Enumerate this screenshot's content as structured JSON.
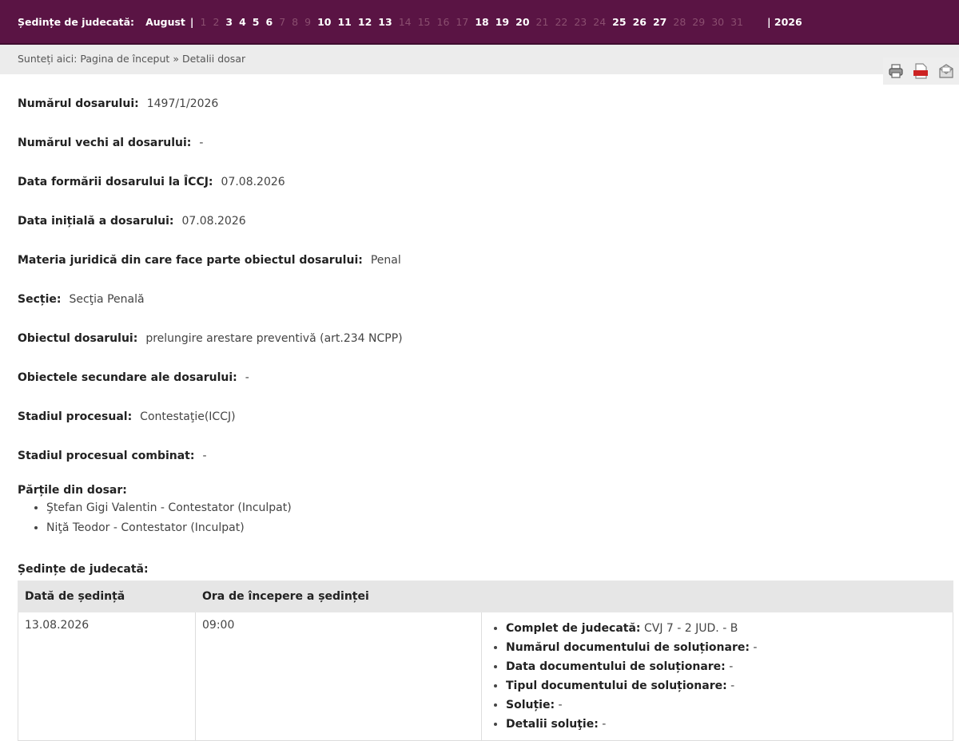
{
  "topbar": {
    "label": "Ședințe de judecată:",
    "month": "August",
    "separator": "|",
    "year": "| 2026",
    "days": [
      {
        "n": "1",
        "active": false
      },
      {
        "n": "2",
        "active": false
      },
      {
        "n": "3",
        "active": true
      },
      {
        "n": "4",
        "active": true
      },
      {
        "n": "5",
        "active": true
      },
      {
        "n": "6",
        "active": true
      },
      {
        "n": "7",
        "active": false
      },
      {
        "n": "8",
        "active": false
      },
      {
        "n": "9",
        "active": false
      },
      {
        "n": "10",
        "active": true
      },
      {
        "n": "11",
        "active": true
      },
      {
        "n": "12",
        "active": true
      },
      {
        "n": "13",
        "active": true
      },
      {
        "n": "14",
        "active": false
      },
      {
        "n": "15",
        "active": false
      },
      {
        "n": "16",
        "active": false
      },
      {
        "n": "17",
        "active": false
      },
      {
        "n": "18",
        "active": true
      },
      {
        "n": "19",
        "active": true
      },
      {
        "n": "20",
        "active": true
      },
      {
        "n": "21",
        "active": false
      },
      {
        "n": "22",
        "active": false
      },
      {
        "n": "23",
        "active": false
      },
      {
        "n": "24",
        "active": false
      },
      {
        "n": "25",
        "active": true
      },
      {
        "n": "26",
        "active": true
      },
      {
        "n": "27",
        "active": true
      },
      {
        "n": "28",
        "active": false
      },
      {
        "n": "29",
        "active": false
      },
      {
        "n": "30",
        "active": false
      },
      {
        "n": "31",
        "active": false
      }
    ]
  },
  "breadcrumb": {
    "prefix": "Sunteți aici:",
    "home": "Pagina de început",
    "sep": "»",
    "current": "Detalii dosar"
  },
  "tools": [
    "printer-icon",
    "pdf-icon",
    "email-icon"
  ],
  "fields": [
    {
      "label": "Numărul dosarului:",
      "value": "1497/1/2026"
    },
    {
      "label": "Numărul vechi al dosarului:",
      "value": "-"
    },
    {
      "label": "Data formării dosarului la ÎCCJ:",
      "value": "07.08.2026"
    },
    {
      "label": "Data inițială a dosarului:",
      "value": "07.08.2026"
    },
    {
      "label": "Materia juridică din care face parte obiectul dosarului:",
      "value": "Penal"
    },
    {
      "label": "Secție:",
      "value": "Secţia Penală"
    },
    {
      "label": "Obiectul dosarului:",
      "value": "prelungire arestare preventivă (art.234 NCPP)"
    },
    {
      "label": "Obiectele secundare ale dosarului:",
      "value": "-"
    },
    {
      "label": "Stadiul procesual:",
      "value": "Contestaţie(ICCJ)"
    },
    {
      "label": "Stadiul procesual combinat:",
      "value": "-"
    }
  ],
  "parties": {
    "title": "Părțile din dosar:",
    "items": [
      "Ştefan Gigi Valentin - Contestator (Inculpat)",
      "Niţă Teodor - Contestator (Inculpat)"
    ]
  },
  "hearings": {
    "title": "Ședințe de judecată:",
    "headers": [
      "Dată de ședință",
      "Ora de începere a ședinței",
      ""
    ],
    "rows": [
      {
        "date": "13.08.2026",
        "time": "09:00",
        "details": [
          {
            "k": "Complet de judecată:",
            "v": "CVJ 7 - 2 JUD. - B"
          },
          {
            "k": "Numărul documentului de soluționare:",
            "v": "-"
          },
          {
            "k": "Data documentului de soluționare:",
            "v": "-"
          },
          {
            "k": "Tipul documentului de soluționare:",
            "v": "-"
          },
          {
            "k": "Soluție:",
            "v": "-"
          },
          {
            "k": "Detalii soluţie:",
            "v": "-"
          }
        ]
      }
    ]
  },
  "colors": {
    "topbar": "#5a1444",
    "inactive_day": "#8a4e6f",
    "breadcrumb_bg": "#ececec"
  }
}
